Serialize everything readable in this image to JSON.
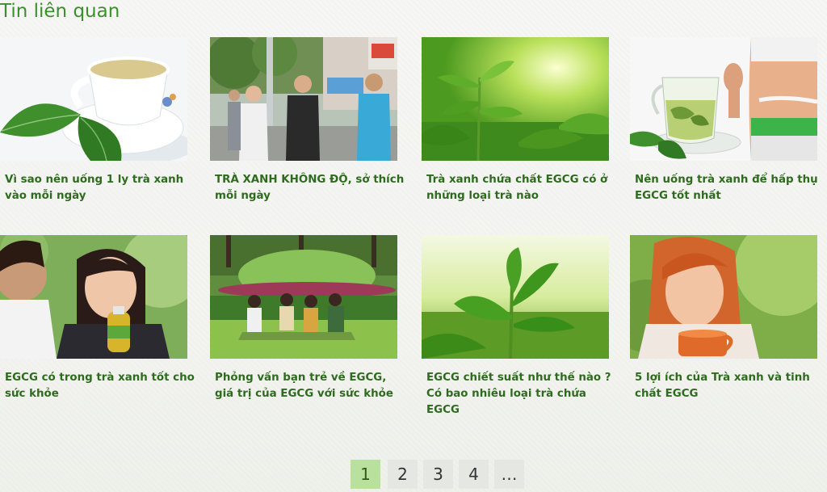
{
  "section_title": "Tin liên quan",
  "articles": [
    {
      "title": "Vì sao nên uống 1 ly trà xanh vào mỗi ngày",
      "image": "tea-cup-with-leaves"
    },
    {
      "title": "TRÀ XANH KHÔNG ĐỘ, sở thích mỗi ngày",
      "image": "young-people-street"
    },
    {
      "title": "Trà xanh chứa chất EGCG có ở những loại trà nào",
      "image": "tea-sprouts-sunlight"
    },
    {
      "title": "Nên uống trà xanh để hấp thụ EGCG tốt nhất",
      "image": "tea-glass-fit-waist"
    },
    {
      "title": "EGCG có trong trà xanh tốt cho sức khỏe",
      "image": "smiling-girl-tea-bottle"
    },
    {
      "title": "Phỏng vấn bạn trẻ về EGCG, giá trị của EGCG với sức khỏe",
      "image": "group-in-park"
    },
    {
      "title": "EGCG chiết suất như thế nào ? Có bao nhiêu loại trà chứa EGCG",
      "image": "tea-bud-closeup"
    },
    {
      "title": "5 lợi ích của Trà xanh và tinh chất EGCG",
      "image": "woman-smelling-tea"
    }
  ],
  "pagination": {
    "pages": [
      "1",
      "2",
      "3",
      "4",
      "…"
    ],
    "current": "1"
  },
  "colors": {
    "accent": "#3d8f2e",
    "caption": "#2f6b1f",
    "page_active_bg": "#b9e09c",
    "page_bg": "#e5e7e2"
  }
}
